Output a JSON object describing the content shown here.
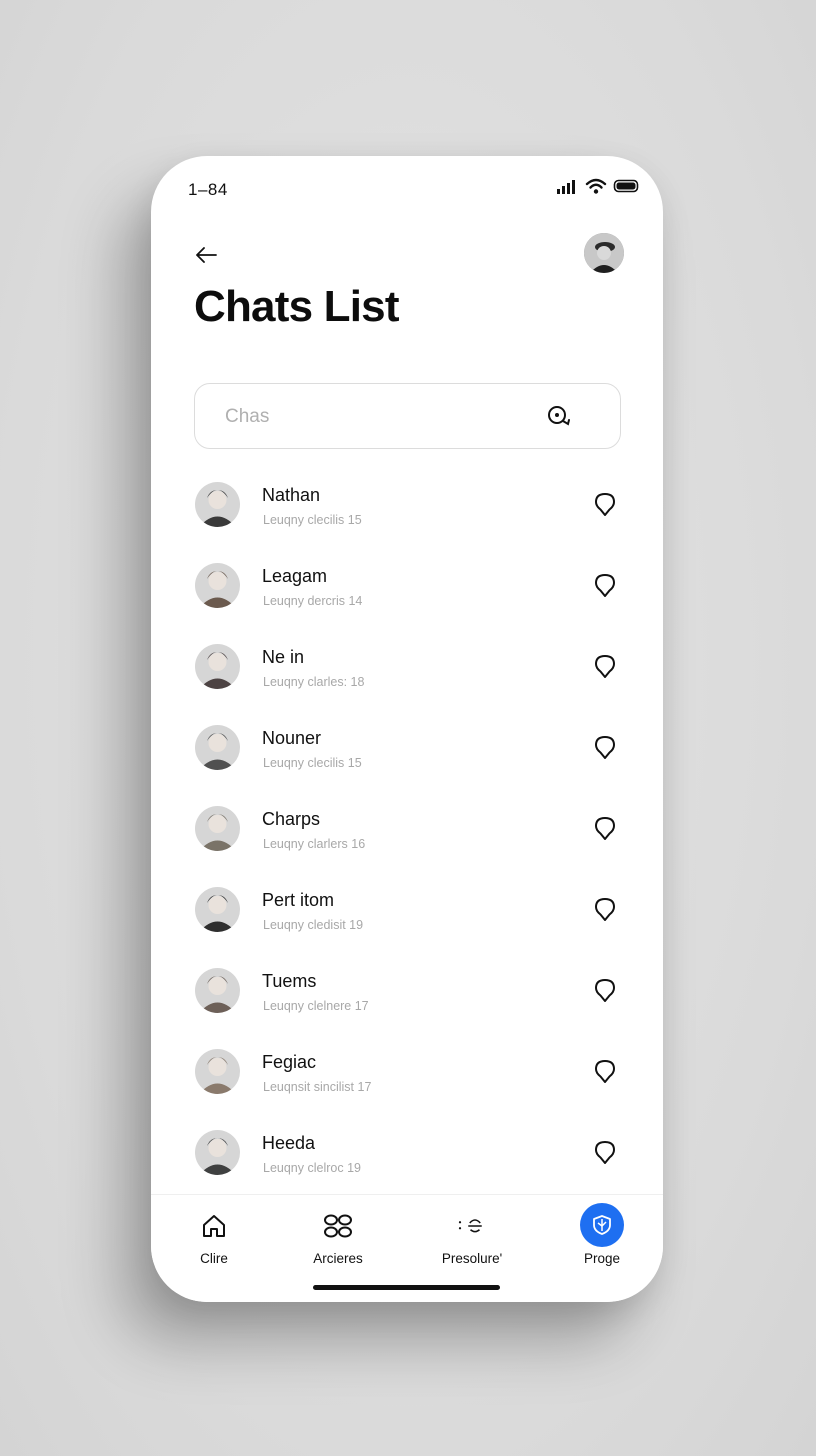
{
  "status_bar": {
    "time": "1–8​4"
  },
  "header": {
    "title": "Chats List"
  },
  "search": {
    "placeholder": "Chas"
  },
  "chats": [
    {
      "name": "Nathan",
      "preview": "Leuqny clecilis 15",
      "avatar_tone": "#3a3a3a"
    },
    {
      "name": "Leagam",
      "preview": "Leuqny dercris 14",
      "avatar_tone": "#6b5a4e"
    },
    {
      "name": "Ne in",
      "preview": "Leuqny clarles: 18",
      "avatar_tone": "#4d4343"
    },
    {
      "name": "Nouner",
      "preview": "Leuqny clecilis 15",
      "avatar_tone": "#505050"
    },
    {
      "name": "Charps",
      "preview": "Leuqny clarlers 16",
      "avatar_tone": "#7a7368"
    },
    {
      "name": "Pert itom",
      "preview": "Leuqny cledisit 19",
      "avatar_tone": "#2e2e2e"
    },
    {
      "name": "Tuems",
      "preview": "Leuqny clelnere 17",
      "avatar_tone": "#6d6058"
    },
    {
      "name": "Fegiac",
      "preview": "Leuqnsit sincilist 17",
      "avatar_tone": "#8a7a6c"
    },
    {
      "name": "Heeda",
      "preview": "Leuqny clelroc 19",
      "avatar_tone": "#3f4040"
    }
  ],
  "tabs": [
    {
      "label": "Clire",
      "icon": "home-icon"
    },
    {
      "label": "Arcieres",
      "icon": "grid-icon"
    },
    {
      "label": "Presolure'",
      "icon": "scan-icon"
    },
    {
      "label": "Proge",
      "icon": "shield-icon"
    }
  ],
  "colors": {
    "accent": "#1e6ff1",
    "title": "#0d0d0d",
    "muted": "#a8a8a8"
  }
}
